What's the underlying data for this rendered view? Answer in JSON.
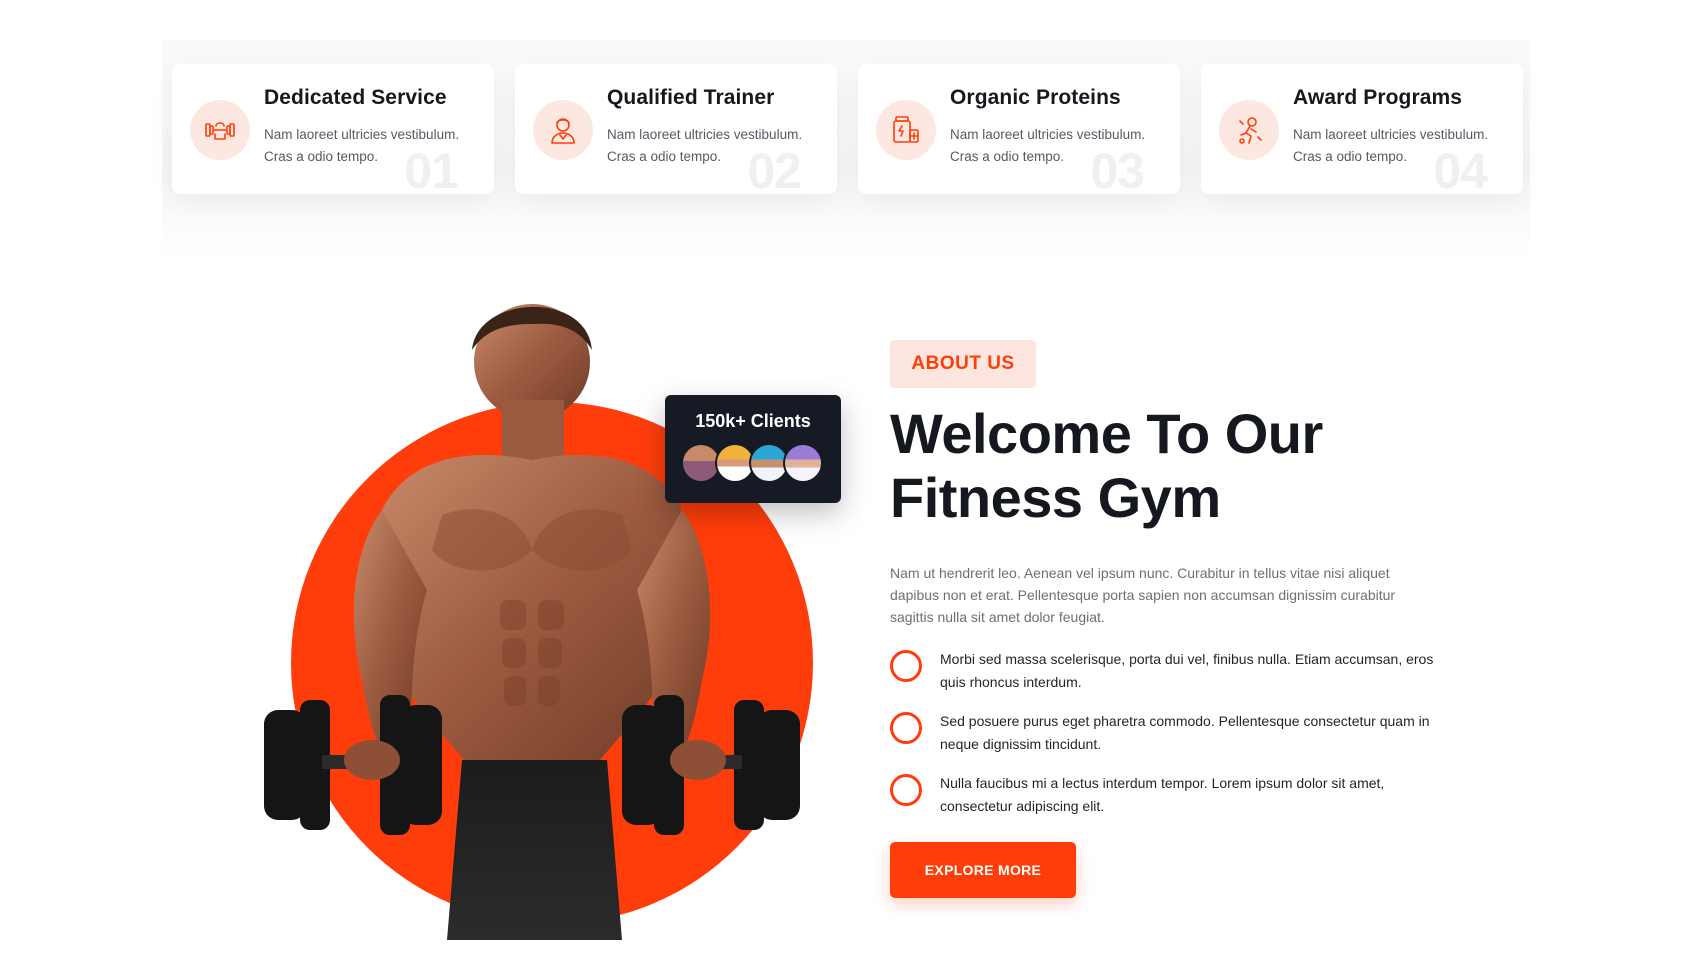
{
  "features": [
    {
      "title": "Dedicated Service",
      "text": "Nam laoreet ultricies vestibulum. Cras a odio tempo.",
      "number": "01",
      "icon": "dumbbell-hand-icon"
    },
    {
      "title": "Qualified Trainer",
      "text": "Nam laoreet ultricies vestibulum. Cras a odio tempo.",
      "number": "02",
      "icon": "trainer-icon"
    },
    {
      "title": "Organic Proteins",
      "text": "Nam laoreet ultricies vestibulum. Cras a odio tempo.",
      "number": "03",
      "icon": "protein-jar-icon"
    },
    {
      "title": "Award Programs",
      "text": "Nam laoreet ultricies vestibulum. Cras a odio tempo.",
      "number": "04",
      "icon": "award-runner-icon"
    }
  ],
  "clients": {
    "label": "150k+ Clients"
  },
  "about": {
    "badge": "ABOUT US",
    "heading_line1": "Welcome To Our",
    "heading_line2": "Fitness Gym",
    "intro": "Nam ut hendrerit leo. Aenean vel ipsum nunc. Curabitur in tellus vitae nisi aliquet dapibus non et erat. Pellentesque porta sapien non accumsan dignissim curabitur sagittis nulla sit amet dolor feugiat.",
    "points": [
      "Morbi sed massa scelerisque, porta dui vel, finibus nulla. Etiam accumsan, eros quis rhoncus interdum.",
      "Sed posuere purus eget pharetra commodo. Pellentesque consectetur quam in neque dignissim tincidunt.",
      "Nulla faucibus mi a lectus interdum tempor. Lorem ipsum dolor sit amet, consectetur adipiscing elit."
    ],
    "button_label": "EXPLORE MORE"
  },
  "colors": {
    "accent": "#ff3d0b",
    "accent_soft": "#fde6df",
    "dark": "#151a24",
    "text": "#15181f",
    "muted": "#6b6f77"
  }
}
